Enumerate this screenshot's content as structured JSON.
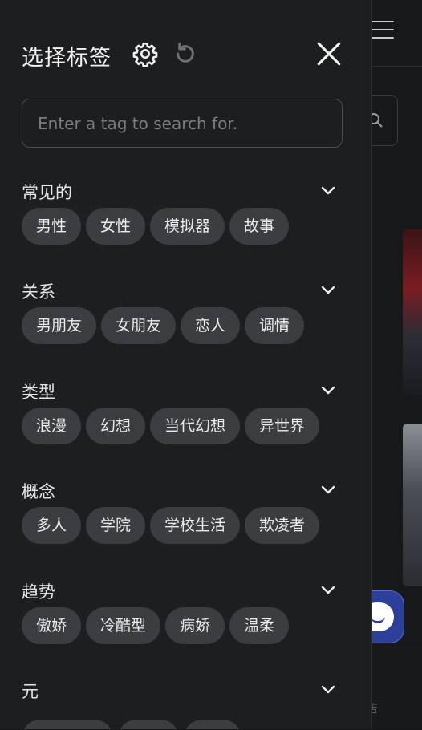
{
  "panel": {
    "title": "选择标签",
    "search_placeholder": "Enter a tag to search for.",
    "sections": [
      {
        "title": "常见的",
        "tags": [
          "男性",
          "女性",
          "模拟器",
          "故事"
        ]
      },
      {
        "title": "关系",
        "tags": [
          "男朋友",
          "女朋友",
          "恋人",
          "调情"
        ]
      },
      {
        "title": "类型",
        "tags": [
          "浪漫",
          "幻想",
          "当代幻想",
          "异世界"
        ]
      },
      {
        "title": "概念",
        "tags": [
          "多人",
          "学院",
          "学校生活",
          "欺凌者"
        ]
      },
      {
        "title": "趋势",
        "tags": [
          "傲娇",
          "冷酷型",
          "病娇",
          "温柔"
        ]
      },
      {
        "title": "元",
        "tags": []
      }
    ]
  },
  "background": {
    "bottom_label": "店"
  },
  "icons": {
    "settings": "gear-icon",
    "reset": "refresh-icon",
    "close": "close-icon",
    "expand": "chevron-down-icon",
    "menu": "hamburger-icon",
    "search": "search-icon",
    "chat": "chat-bubble-icon"
  },
  "colors": {
    "panel_bg": "#1d1e20",
    "tag_bg": "#3c3d40",
    "chat_accent": "#2c3f9a"
  }
}
